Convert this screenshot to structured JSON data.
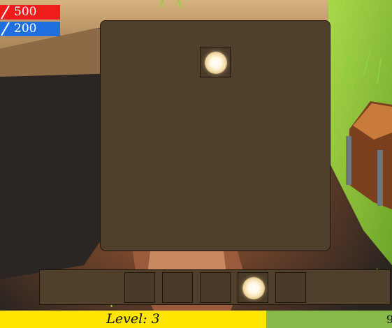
{
  "hud": {
    "health_value": "500",
    "mana_value": "200",
    "health_color": "#ef1c1c",
    "mana_color": "#1f6fe0"
  },
  "inventory": {
    "slots": [
      {
        "item": "light-orb"
      }
    ]
  },
  "hotbar": {
    "slots": [
      {
        "item": null
      },
      {
        "item": null
      },
      {
        "item": null
      },
      {
        "item": "light-orb"
      },
      {
        "item": null
      }
    ]
  },
  "level_bar": {
    "label": "Level: 3",
    "color": "#ffe600"
  },
  "corner": {
    "number": "9"
  }
}
